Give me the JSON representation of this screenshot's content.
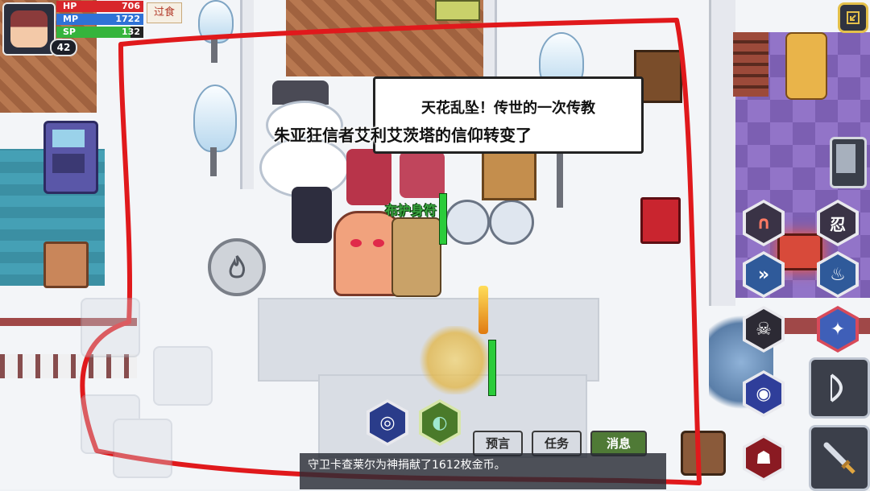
{
  "player": {
    "level": "42",
    "hp": {
      "label": "HP",
      "value": "706",
      "fill": 1.0,
      "color": "#d8262b"
    },
    "mp": {
      "label": "MP",
      "value": "1722",
      "fill": 1.0,
      "color": "#2f72d6"
    },
    "sp": {
      "label": "SP",
      "value": "132",
      "fill": 0.85,
      "color": "#35b43c"
    }
  },
  "top_tag": "过食",
  "speech_bubble": "天花乱坠！传世的一次传教",
  "announcement": "朱亚狂信者艾利艾茨塔的信仰转变了",
  "skill_popup": "布护身符",
  "bottom_tabs": [
    {
      "label": "预言",
      "active": false
    },
    {
      "label": "任务",
      "active": false
    },
    {
      "label": "消息",
      "active": true
    }
  ],
  "chat": {
    "line1": "守卫卡查莱尔为神捐献了1612枚金币。"
  },
  "icons": {
    "top_right": "window-toggle-icon",
    "skills_right": [
      "gate-skill-icon",
      "ninja-skill-icon",
      "dash-skill-icon",
      "flame-skill-icon",
      "skull-skill-icon",
      "compass-skill-icon",
      "eye-skill-icon",
      "demon-skill-icon"
    ],
    "bottom_center": [
      "portal-skill-icon",
      "goggles-item-icon"
    ],
    "attack": "sword-attack-icon",
    "bow": "bow-weapon-icon",
    "phone": "phone-icon",
    "book": "red-book-icon",
    "round_action": "fire-action-icon"
  },
  "colors": {
    "annotation_red": "#e0191c",
    "accent_green": "#4f7a36"
  }
}
